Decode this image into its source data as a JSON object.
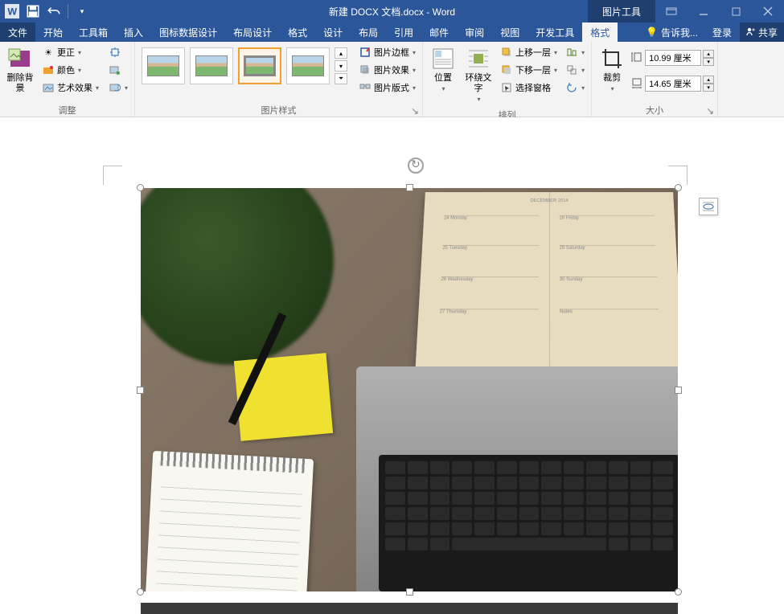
{
  "titlebar": {
    "doc_title": "新建 DOCX 文档.docx - Word",
    "contextual_tab": "图片工具"
  },
  "tabs": {
    "file": "文件",
    "home": "开始",
    "toolbox": "工具箱",
    "insert": "插入",
    "chart_design": "图标数据设计",
    "layout_design": "布局设计",
    "format1": "格式",
    "design": "设计",
    "layout": "布局",
    "references": "引用",
    "mailings": "邮件",
    "review": "审阅",
    "view": "视图",
    "developer": "开发工具",
    "format": "格式",
    "tell_me": "告诉我...",
    "login": "登录",
    "share": "共享"
  },
  "ribbon": {
    "remove_bg": "删除背景",
    "corrections": "更正",
    "color": "颜色",
    "artistic": "艺术效果",
    "adjust_label": "调整",
    "styles_label": "图片样式",
    "picture_border": "图片边框",
    "picture_effects": "图片效果",
    "picture_layout": "图片版式",
    "position": "位置",
    "wrap_text": "环绕文字",
    "bring_forward": "上移一层",
    "send_backward": "下移一层",
    "selection_pane": "选择窗格",
    "arrange_label": "排列",
    "crop": "裁剪",
    "height_value": "10.99 厘米",
    "width_value": "14.65 厘米",
    "size_label": "大小"
  }
}
